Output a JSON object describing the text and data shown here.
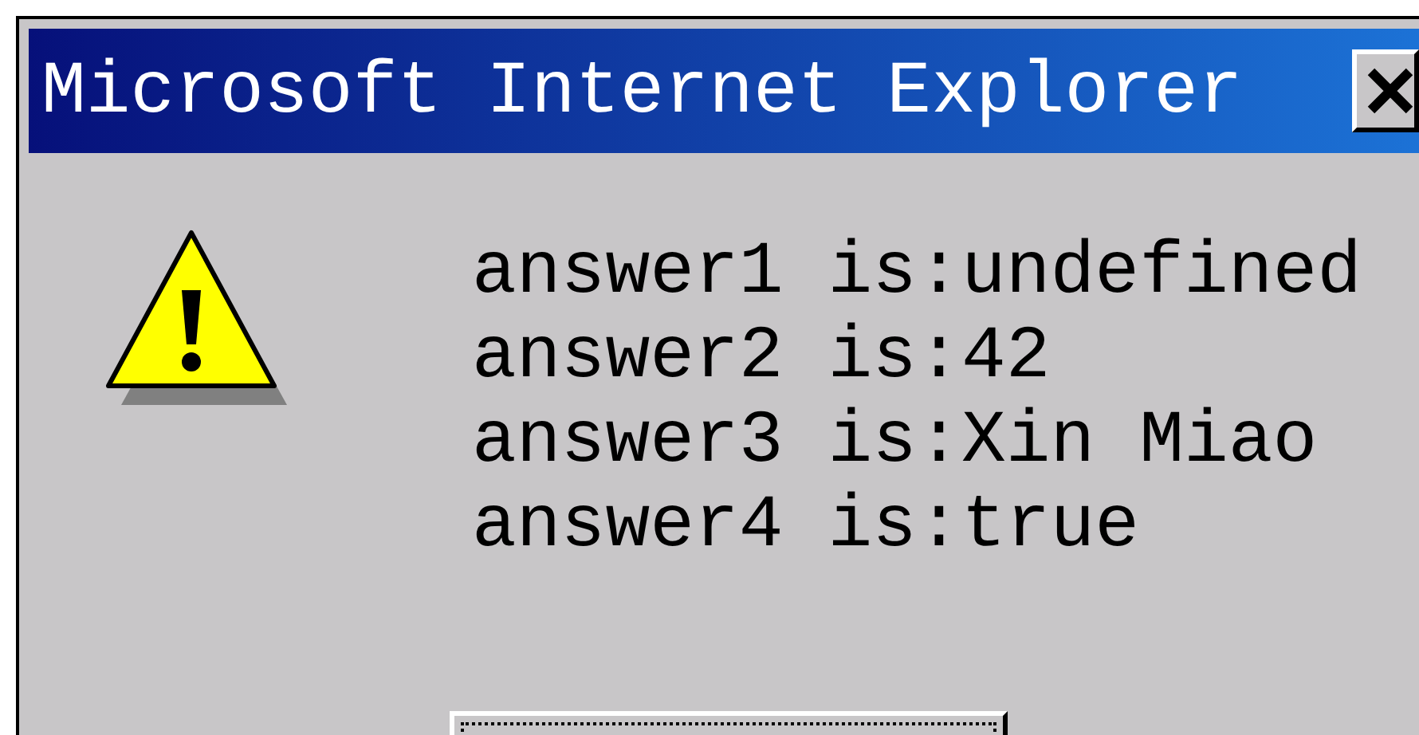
{
  "window": {
    "title": "Microsoft Internet Explorer"
  },
  "message": {
    "kind": "warning",
    "lines": [
      "answer1 is:undefined",
      "answer2 is:42",
      "answer3 is:Xin Miao",
      "answer4 is:true"
    ]
  },
  "button": {
    "focused": true
  }
}
